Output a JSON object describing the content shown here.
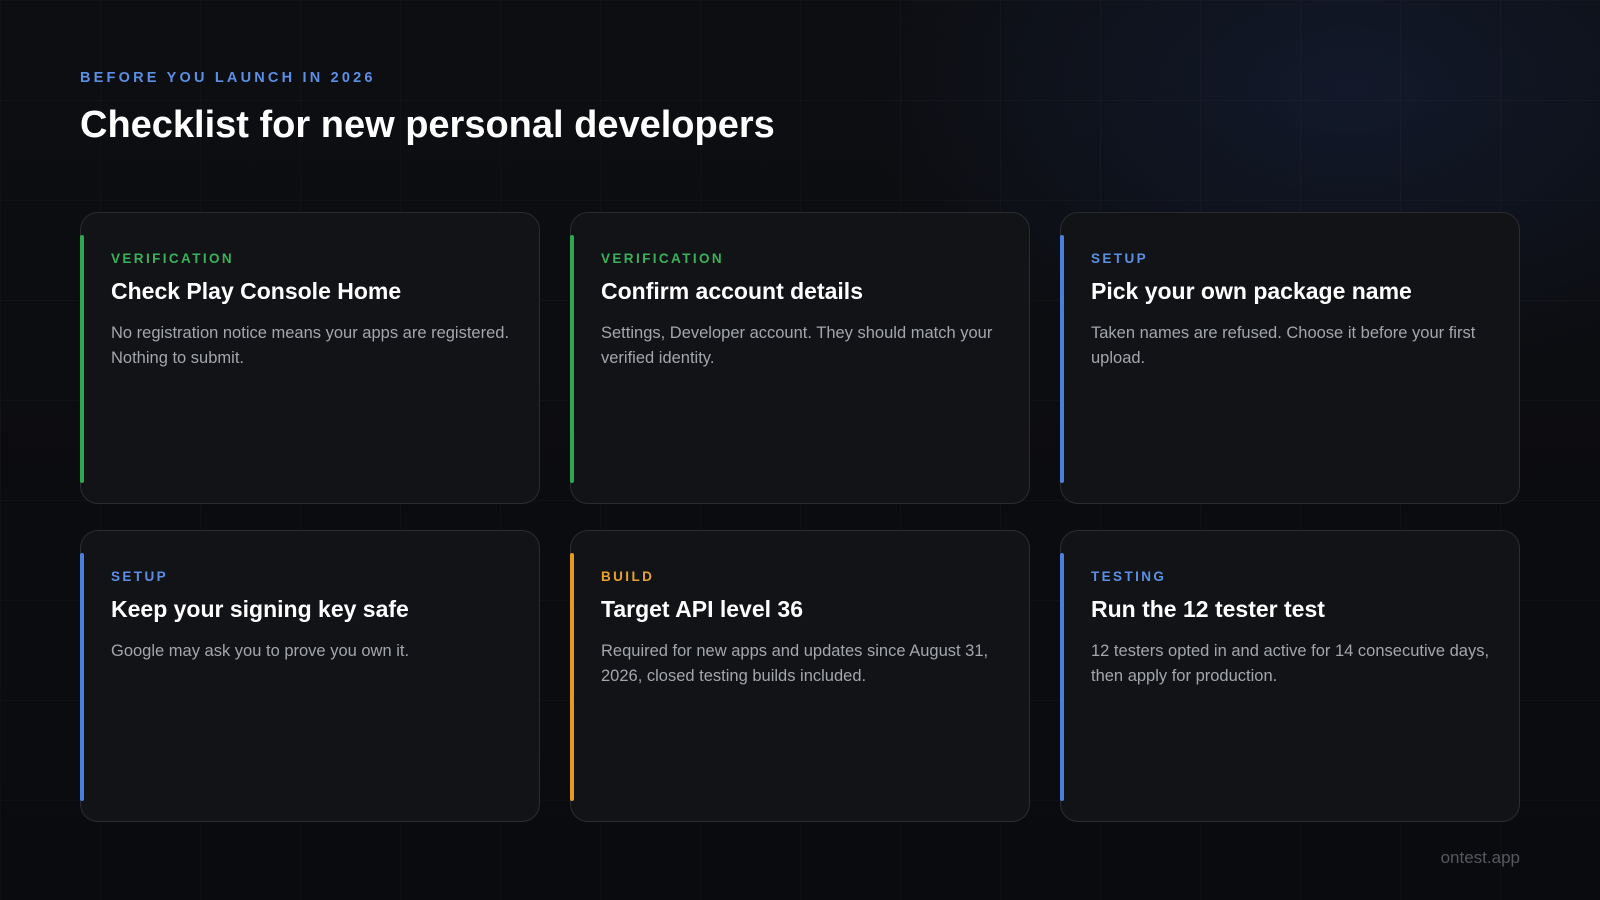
{
  "header": {
    "eyebrow": "BEFORE YOU LAUNCH IN 2026",
    "title": "Checklist for new personal developers"
  },
  "colors": {
    "verification": "#2ea84f",
    "setup": "#4a80dc",
    "build": "#e59a21",
    "testing": "#4a80dc",
    "verification_text": "#38b25a",
    "setup_text": "#5b8fe6",
    "build_text": "#e8a22e",
    "testing_text": "#5b8fe6"
  },
  "cards": [
    {
      "tag": "VERIFICATION",
      "title": "Check Play Console Home",
      "description": "No registration notice means your apps are registered. Nothing to submit."
    },
    {
      "tag": "VERIFICATION",
      "title": "Confirm account details",
      "description": "Settings, Developer account. They should match your verified identity."
    },
    {
      "tag": "SETUP",
      "title": "Pick your own package name",
      "description": "Taken names are refused. Choose it before your first upload."
    },
    {
      "tag": "SETUP",
      "title": "Keep your signing key safe",
      "description": "Google may ask you to prove you own it."
    },
    {
      "tag": "BUILD",
      "title": "Target API level 36",
      "description": "Required for new apps and updates since August 31, 2026, closed testing builds included."
    },
    {
      "tag": "TESTING",
      "title": "Run the 12 tester test",
      "description": "12 testers opted in and active for 14 consecutive days, then apply for production."
    }
  ],
  "footer": {
    "brand": "ontest.app"
  }
}
